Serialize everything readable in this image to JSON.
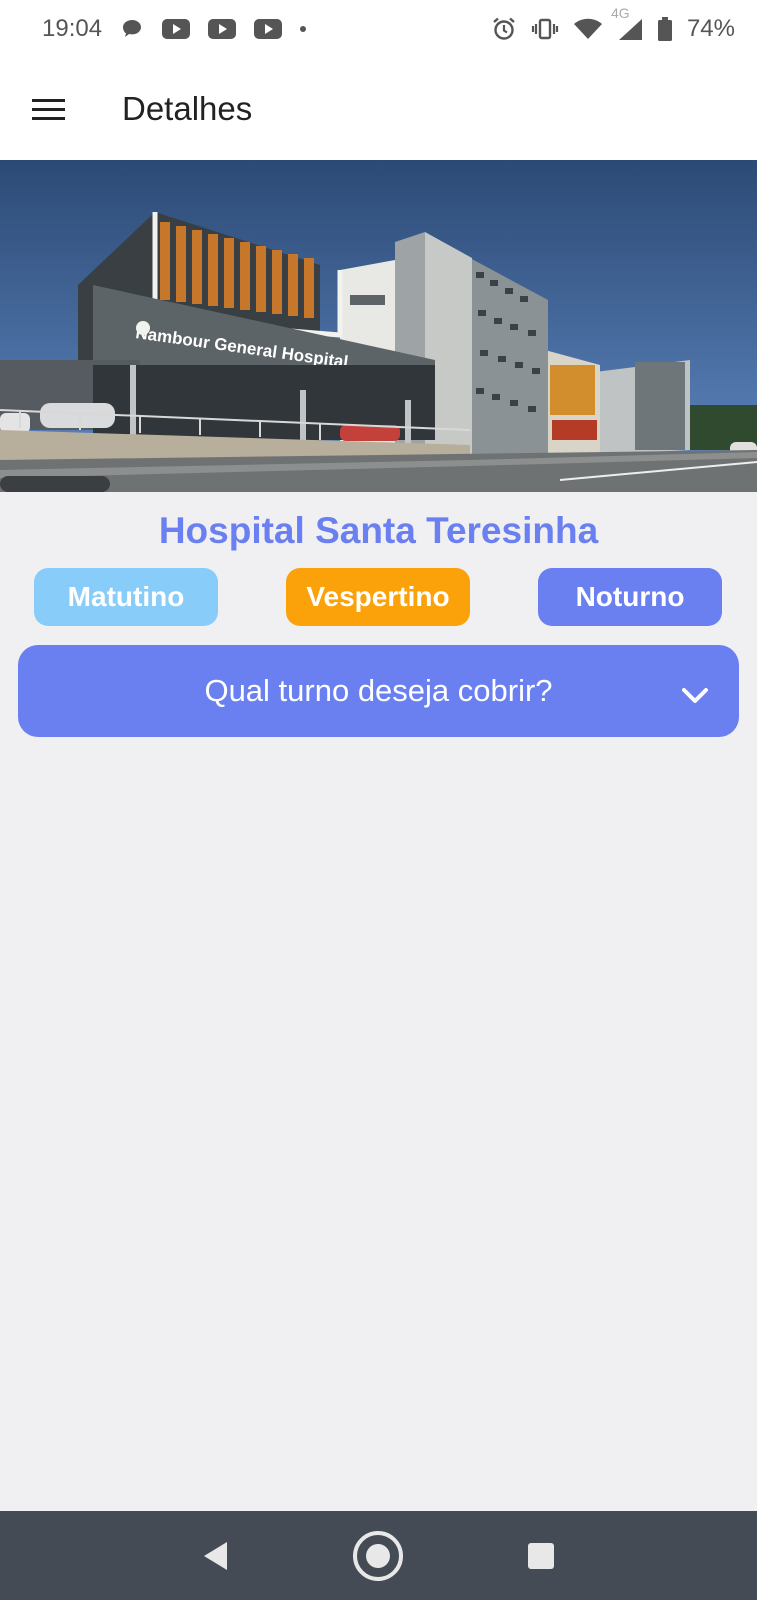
{
  "status_bar": {
    "time": "19:04",
    "network": "4G",
    "battery": "74%",
    "icons": [
      "chat-bubble-icon",
      "youtube-icon",
      "youtube-icon",
      "youtube-icon",
      "dot-icon",
      "alarm-icon",
      "vibrate-icon",
      "wifi-icon",
      "signal-icon",
      "battery-icon"
    ]
  },
  "app_bar": {
    "title": "Detalhes",
    "menu_icon": "hamburger-menu-icon"
  },
  "hero": {
    "sign_text": "Nambour General Hospital"
  },
  "hospital": {
    "name": "Hospital Santa Teresinha"
  },
  "shifts": {
    "morning": "Matutino",
    "afternoon": "Vespertino",
    "night": "Noturno"
  },
  "dropdown": {
    "label": "Qual turno deseja cobrir?",
    "icon": "chevron-down-icon"
  },
  "nav": {
    "back_icon": "back-triangle-icon",
    "home_icon": "home-circle-icon",
    "recents_icon": "recents-square-icon"
  },
  "colors": {
    "accent": "#6a80f0",
    "morning": "#88cdfa",
    "afternoon": "#fba20b",
    "background": "#f0f0f2",
    "nav_bar": "#454b55"
  }
}
